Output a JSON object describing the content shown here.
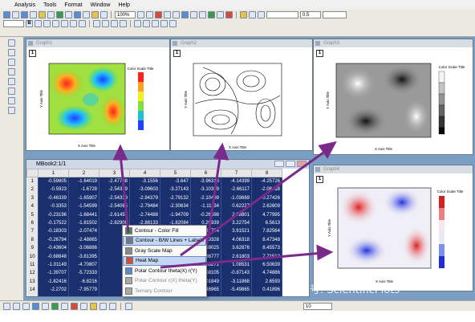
{
  "menubar": {
    "items": [
      "Analysis",
      "Tools",
      "Format",
      "Window",
      "Help"
    ]
  },
  "toolbar": {
    "zoom_value": "100%",
    "line_width_value": "0.5",
    "font_size_value": "10"
  },
  "graphs": [
    {
      "title": "Graph1",
      "layer": "1",
      "xlabel": "X Axis Title",
      "ylabel": "Y Axis Title",
      "colorscale_title": "Color Scale Title"
    },
    {
      "title": "Graph2",
      "layer": "1",
      "xlabel": "X Axis Title",
      "ylabel": "Y Axis Title"
    },
    {
      "title": "Graph3",
      "layer": "1",
      "xlabel": "X Axis Title",
      "ylabel": "Y Axis Title",
      "colorscale_title": "Color Scale Title"
    },
    {
      "title": "Graph4",
      "layer": "1",
      "xlabel": "X Axis Title",
      "ylabel": "Y Axis Title",
      "colorscale_title": "Color Scale Title"
    }
  ],
  "workbook": {
    "title": "MBook2:1/1",
    "columns": [
      "",
      "1",
      "2",
      "3",
      "4",
      "5",
      "6",
      "7",
      "8"
    ],
    "rows": [
      [
        "1",
        "-0.59805",
        "-1.64019",
        "-2.47788",
        "-3.1556",
        "-3.647",
        "-3.96318",
        "-4.14399",
        "-4.25726"
      ],
      [
        "2",
        "-0.5923",
        "-1.6728",
        "-2.54339",
        "-3.09603",
        "-3.27143",
        "-3.10359",
        "-2.66117",
        "-2.08418"
      ],
      [
        "3",
        "-0.46339",
        "-1.65907",
        "-2.54339",
        "-2.94379",
        "-2.79132",
        "-2.10499",
        "-1.03669",
        "0.27426"
      ],
      [
        "4",
        "-0.3353",
        "-1.54599",
        "-2.54065",
        "-2.79484",
        "-2.30634",
        "-1.11134",
        "0.62227",
        "2.62609"
      ],
      [
        "5",
        "-0.23196",
        "-1.68441",
        "-2.61457",
        "-2.74488",
        "-1.94709",
        "-0.26598",
        "2.08801",
        "4.77995"
      ],
      [
        "6",
        "-0.17522",
        "-1.81502",
        "-2.82909",
        "-2.88133",
        "-1.82084",
        "0.29939",
        "3.22754",
        "6.5613"
      ],
      [
        "7",
        "-0.18303",
        "-2.07474",
        "",
        "",
        "",
        "0.47764",
        "3.91521",
        "7.82564"
      ],
      [
        "8",
        "-0.26794",
        "-2.48865",
        "",
        "",
        "",
        "0.19328",
        "4.06318",
        "8.47348"
      ],
      [
        "9",
        "-0.43604",
        "-3.06886",
        "",
        "",
        "",
        "-0.59025",
        "3.62876",
        "8.45573"
      ],
      [
        "10",
        "-0.68648",
        "-3.81395",
        "",
        "",
        "",
        "-1.86777",
        "2.61803",
        "7.71512"
      ],
      [
        "11",
        "-1.01149",
        "-4.70807",
        "",
        "",
        "",
        "-3.58271",
        "1.08531",
        "6.50639"
      ],
      [
        "12",
        "-1.39707",
        "-5.72333",
        "",
        "",
        "",
        "-5.58105",
        "-0.87143",
        "4.74886"
      ],
      [
        "13",
        "-1.82416",
        "-6.8216",
        "",
        "",
        "",
        "-8.01849",
        "-3.11868",
        "2.6593"
      ],
      [
        "14",
        "-2.2702",
        "-7.95779",
        "",
        "",
        "",
        "-10.46965",
        "-5.49865",
        "0.41896"
      ],
      [
        "15",
        "-2.71108",
        "-9.08364",
        "",
        "",
        "",
        "-12.86952",
        "-7.84348",
        "-1.81454"
      ]
    ]
  },
  "context_menu": {
    "items": [
      {
        "label": "Contour - Color Fill",
        "highlight": false,
        "disabled": false,
        "color": "#3a9a4a"
      },
      {
        "label": "Contour - B/W Lines + Labels",
        "highlight": true,
        "disabled": false,
        "color": "#6a7a8a"
      },
      {
        "label": "Gray Scale Map",
        "highlight": false,
        "disabled": false,
        "color": "#888888"
      },
      {
        "label": "Heat Map",
        "highlight": true,
        "disabled": false,
        "color": "#d64a3a"
      },
      {
        "label": "Polar Contour theta(X) r(Y)",
        "highlight": false,
        "disabled": false,
        "color": "#5b8bd0"
      },
      {
        "label": "Polar Contour r(X) theta(Y)",
        "highlight": false,
        "disabled": true,
        "color": "#aaaaaa"
      },
      {
        "label": "Ternary Contour",
        "highlight": false,
        "disabled": true,
        "color": "#aaaaaa"
      }
    ]
  },
  "watermark": "微信号: ScientificPlots",
  "colors": {
    "workspace": "#7a9ec4",
    "sheet_cells": "#1a2f6e",
    "arrow": "#7a2a8a"
  }
}
